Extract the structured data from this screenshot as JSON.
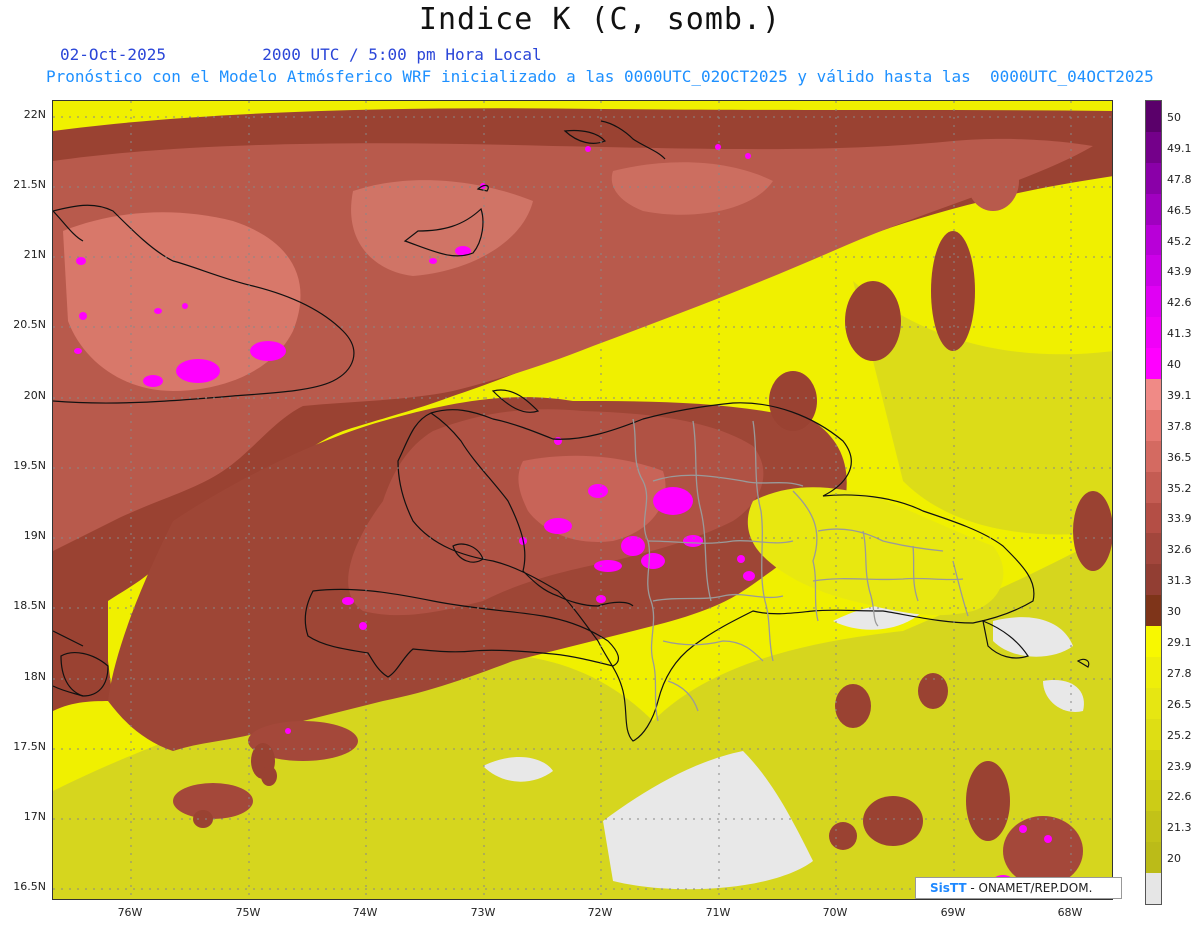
{
  "title": "Indice K (C, somb.)",
  "date_text": "02-Oct-2025",
  "time_text": "2000 UTC / 5:00 pm Hora Local",
  "forecast_text": "Pronóstico con el Modelo Atmósferico WRF inicializado a las 0000UTC_02OCT2025 y válido hasta las  0000UTC_04OCT2025",
  "credit": {
    "brand": "SisTT",
    "rest": " - ONAMET/REP.DOM."
  },
  "map": {
    "lat_labels": [
      "22N",
      "21.5N",
      "21N",
      "20.5N",
      "20N",
      "19.5N",
      "19N",
      "18.5N",
      "18N",
      "17.5N",
      "17N",
      "16.5N"
    ],
    "lon_labels": [
      "76W",
      "75W",
      "74W",
      "73W",
      "72W",
      "71W",
      "70W",
      "69W",
      "68W"
    ]
  },
  "colorbar": {
    "labels": [
      "50",
      "49.1",
      "47.8",
      "46.5",
      "45.2",
      "43.9",
      "42.6",
      "41.3",
      "40",
      "39.1",
      "37.8",
      "36.5",
      "35.2",
      "33.9",
      "32.6",
      "31.3",
      "30",
      "29.1",
      "27.8",
      "26.5",
      "25.2",
      "23.9",
      "22.6",
      "21.3",
      "20"
    ],
    "colors": [
      "#5a006a",
      "#74008a",
      "#8a00a8",
      "#a000c0",
      "#b800d8",
      "#cc00e8",
      "#e000f4",
      "#f000f8",
      "#ff00ff",
      "#f08a86",
      "#e57871",
      "#d46a61",
      "#c45c53",
      "#b44e45",
      "#a2463c",
      "#923e33",
      "#7e3419",
      "#f8f800",
      "#eeee0a",
      "#e6e612",
      "#dede14",
      "#d4d414",
      "#cccc16",
      "#c2c218",
      "#bbbb18",
      "#e6e6e6"
    ]
  },
  "colors": {
    "yellow": "#f0f000",
    "olive": "#d2d21c",
    "brown_dark": "#8c3a2e",
    "brown_mid": "#b8584c",
    "salmon": "#de7a6c",
    "magenta": "#ff00ff",
    "grey": "#e8e8e8"
  }
}
